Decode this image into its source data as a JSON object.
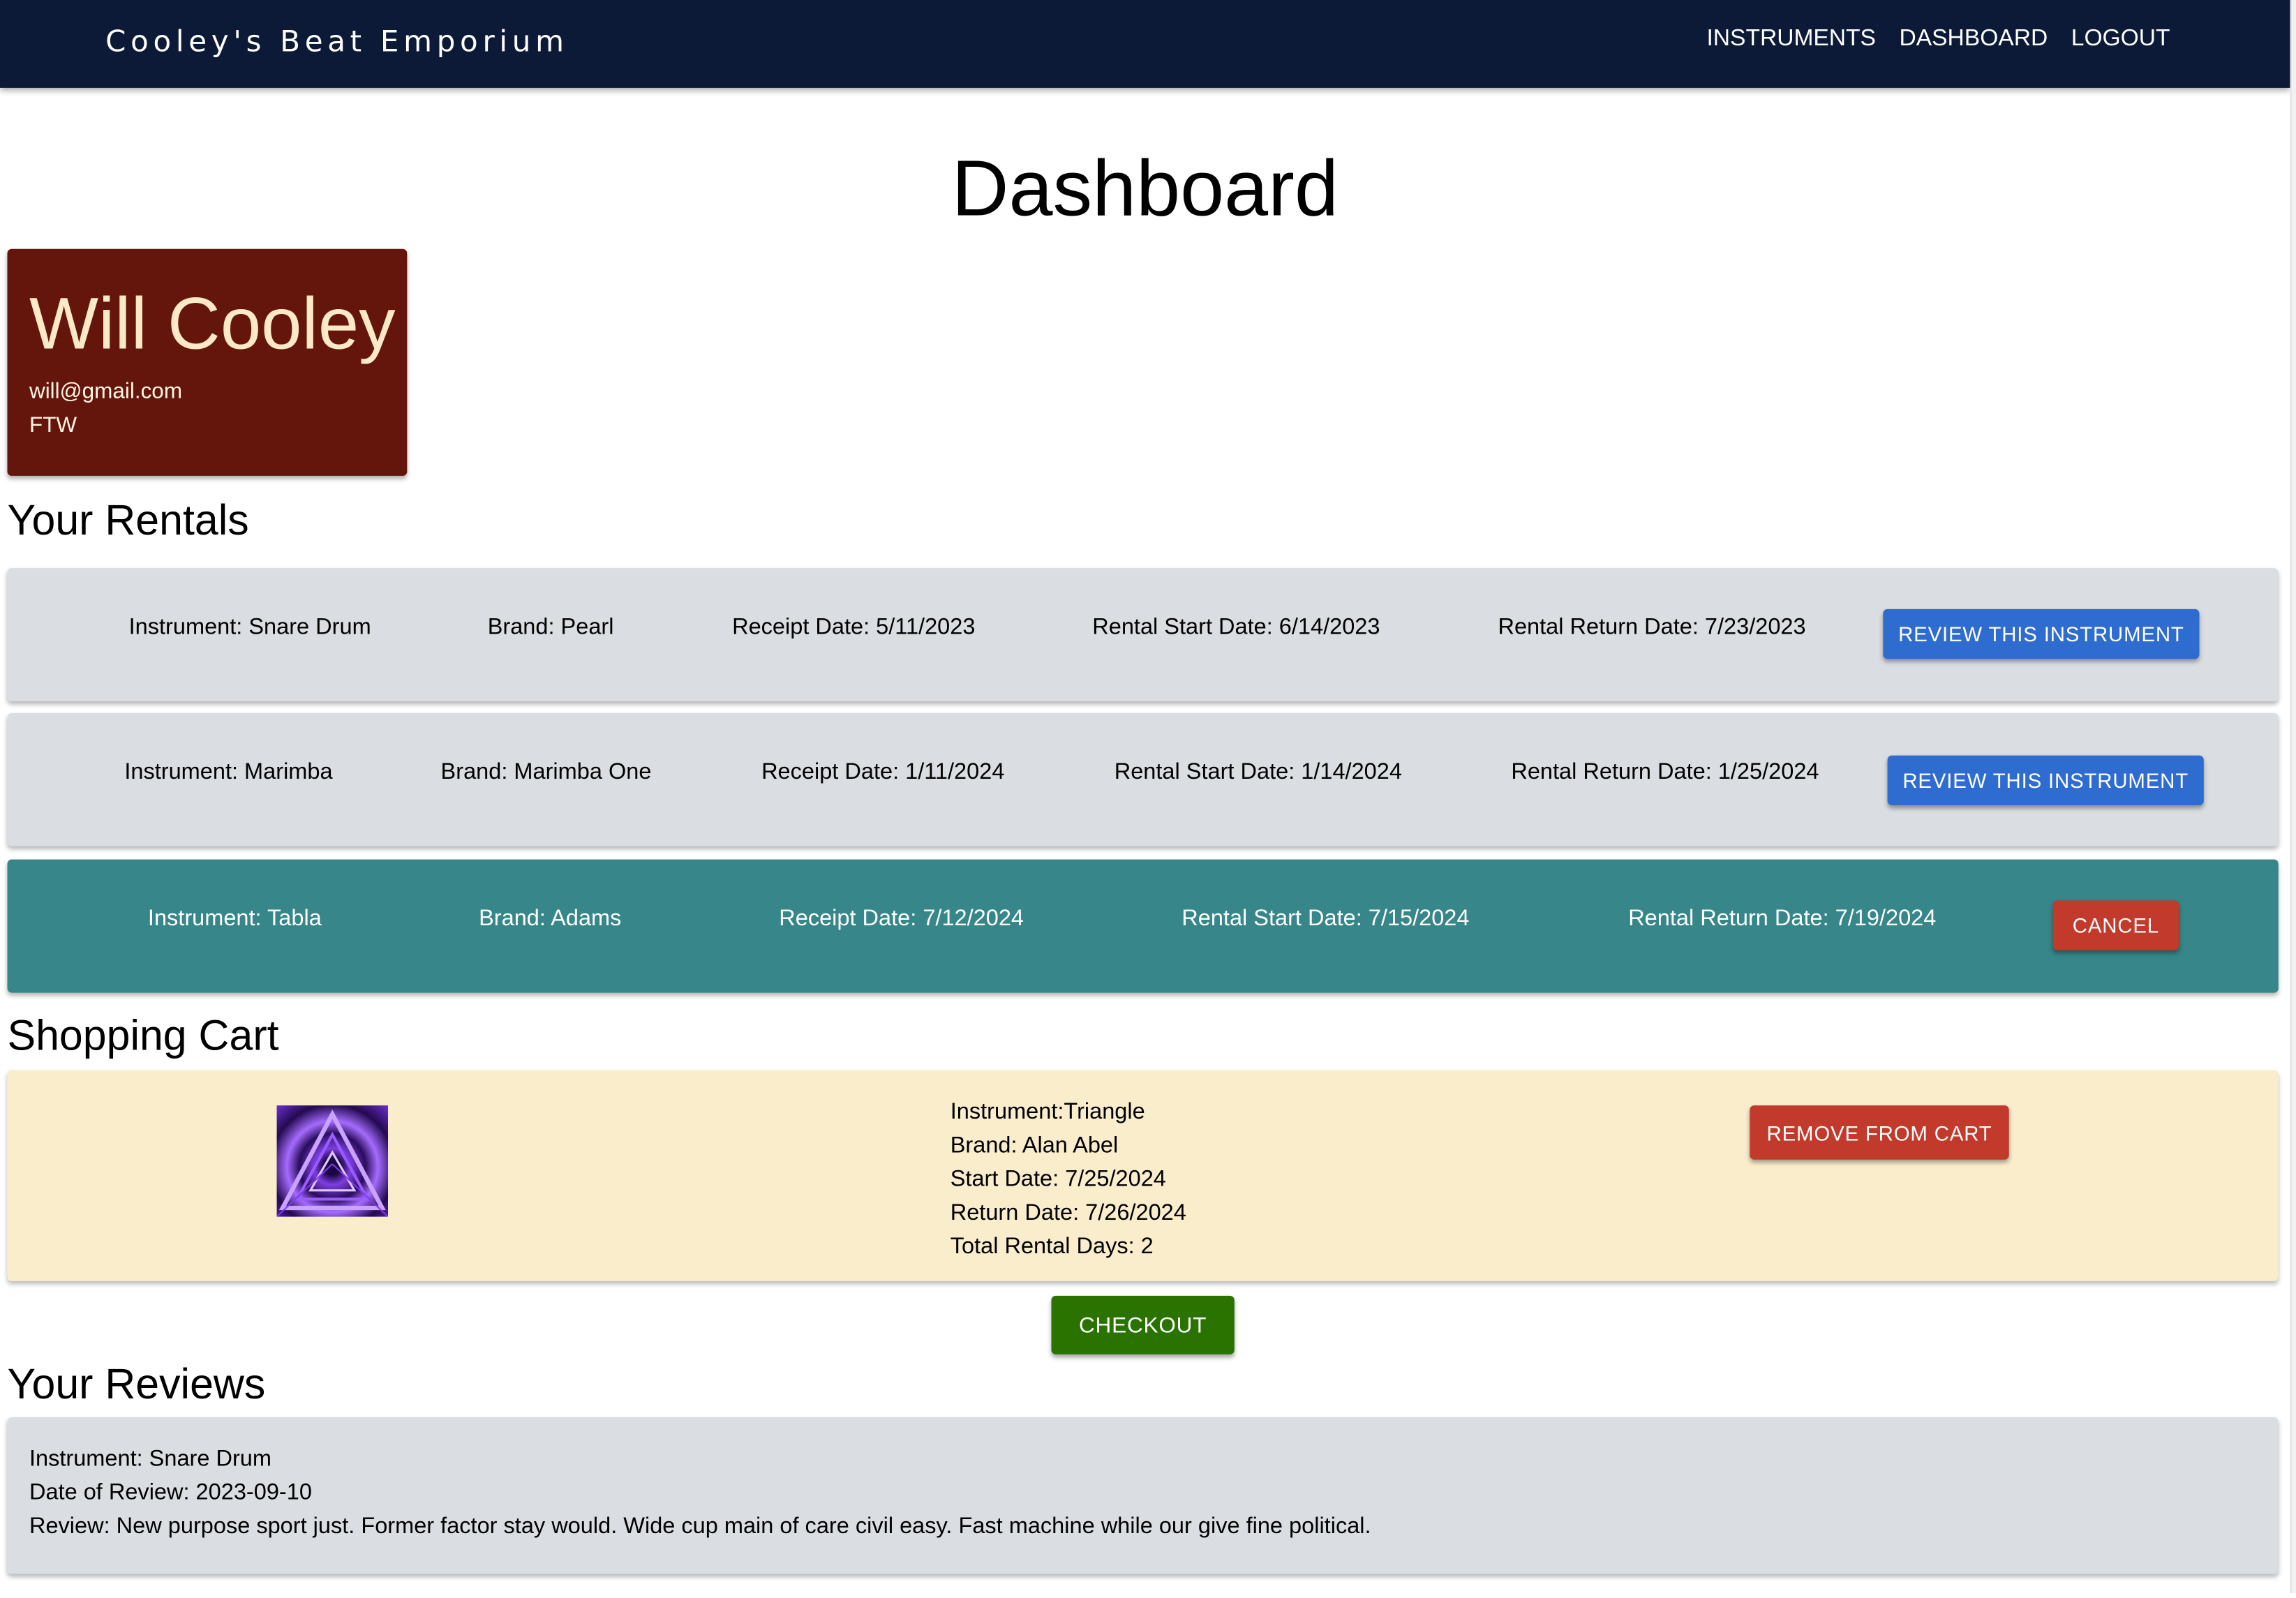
{
  "header": {
    "brand": "Cooley's Beat Emporium",
    "nav": [
      "INSTRUMENTS",
      "DASHBOARD",
      "LOGOUT"
    ]
  },
  "page_title": "Dashboard",
  "profile": {
    "name": "Will Cooley",
    "email": "will@gmail.com",
    "tagline": "FTW"
  },
  "rentals": {
    "title": "Your Rentals",
    "items": [
      {
        "instrument": "Instrument: Snare Drum",
        "brand": "Brand: Pearl",
        "receipt": "Receipt Date: 5/11/2023",
        "start": "Rental Start Date: 6/14/2023",
        "return": "Rental Return Date: 7/23/2023",
        "action": "REVIEW THIS INSTRUMENT"
      },
      {
        "instrument": "Instrument: Marimba",
        "brand": "Brand: Marimba One",
        "receipt": "Receipt Date: 1/11/2024",
        "start": "Rental Start Date: 1/14/2024",
        "return": "Rental Return Date: 1/25/2024",
        "action": "REVIEW THIS INSTRUMENT"
      },
      {
        "instrument": "Instrument: Tabla",
        "brand": "Brand: Adams",
        "receipt": "Receipt Date: 7/12/2024",
        "start": "Rental Start Date: 7/15/2024",
        "return": "Rental Return Date: 7/19/2024",
        "action": "CANCEL"
      }
    ]
  },
  "cart": {
    "title": "Shopping Cart",
    "item": {
      "image_icon": "triangle-photo",
      "instrument": "Instrument:Triangle",
      "brand": "Brand: Alan Abel",
      "start": "Start Date: 7/25/2024",
      "return": "Return Date: 7/26/2024",
      "days": "Total Rental Days: 2",
      "remove_label": "REMOVE FROM CART"
    },
    "checkout_label": "CHECKOUT"
  },
  "reviews": {
    "title": "Your Reviews",
    "items": [
      {
        "instrument": "Instrument: Snare Drum",
        "date": "Date of Review: 2023-09-10",
        "text": "Review: New purpose sport just. Former factor stay would. Wide cup main of care civil easy. Fast machine while our give fine political."
      }
    ]
  },
  "colors": {
    "topbar": "#0c1a37",
    "profile_card": "#64150c",
    "rental_row": "#dadde1",
    "active_rental_row": "#36868a",
    "cart_bg": "#faedcc",
    "review_button": "#2f6ccf",
    "danger_button": "#c13a2c",
    "checkout_button": "#2a7300"
  }
}
